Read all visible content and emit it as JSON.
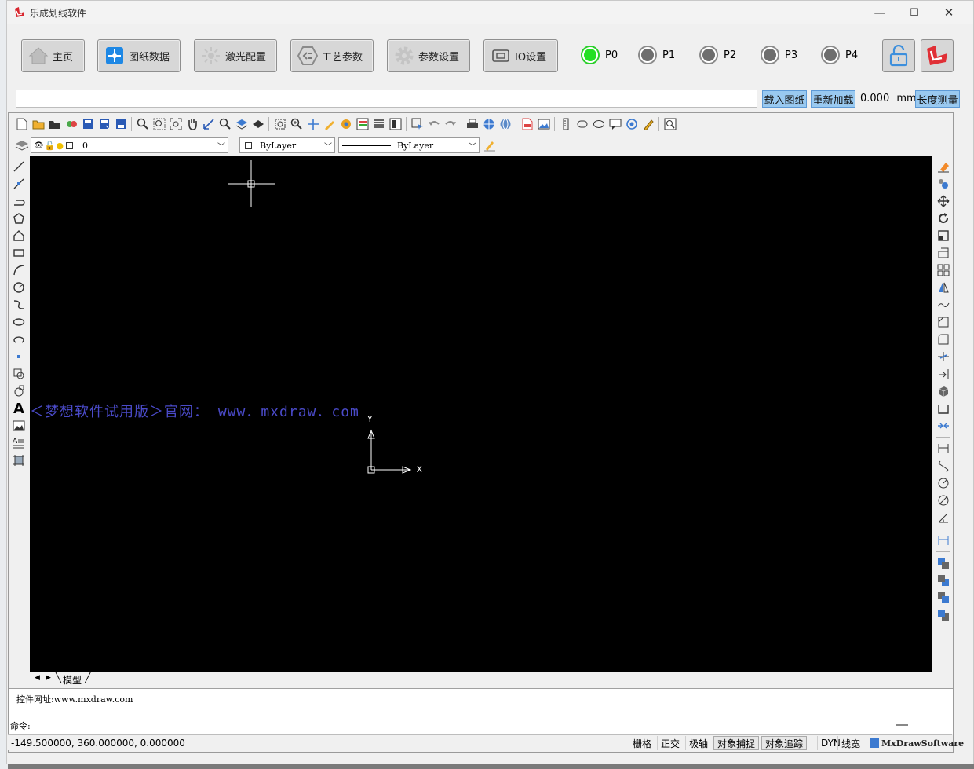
{
  "window": {
    "title": "乐成划线软件",
    "minimize": "—",
    "maximize": "☐",
    "close": "✕"
  },
  "nav": [
    {
      "label": "主页",
      "icon": "home-icon"
    },
    {
      "label": "图纸数据",
      "icon": "drawing-data-icon"
    },
    {
      "label": "激光配置",
      "icon": "laser-icon"
    },
    {
      "label": "工艺参数",
      "icon": "process-params-icon"
    },
    {
      "label": "参数设置",
      "icon": "gear-icon"
    },
    {
      "label": "IO设置",
      "icon": "io-icon"
    }
  ],
  "lamps": [
    {
      "label": "P0",
      "on": true
    },
    {
      "label": "P1",
      "on": false
    },
    {
      "label": "P2",
      "on": false
    },
    {
      "label": "P3",
      "on": false
    },
    {
      "label": "P4",
      "on": false
    }
  ],
  "toolbar2": {
    "load_label": "载入图纸",
    "reload_label": "重新加载",
    "length_value": "0.000",
    "length_unit": "mm",
    "measure_label": "长度测量",
    "filepath": ""
  },
  "cad": {
    "layer": "0",
    "color": "ByLayer",
    "linetype": "ByLayer",
    "watermark": "＜梦想软件试用版＞官网： www．mxdraw．com",
    "axis_y": "Y",
    "axis_x": "X",
    "tab_model": "模型",
    "cmd_history": "控件网址:www.mxdraw.com",
    "cmd_prompt": "命令:"
  },
  "status": {
    "coords": "-149.500000,  360.000000,  0.000000",
    "toggles": [
      "栅格",
      "正交",
      "极轴",
      "对象捕捉",
      "对象追踪",
      "DYN",
      "线宽"
    ],
    "brand": "MxDrawSoftware"
  },
  "colors": {
    "accent_blue": "#99c9f0",
    "lamp_on": "#22e022",
    "canvas_bg": "#000000",
    "watermark": "#4a4ac8"
  }
}
